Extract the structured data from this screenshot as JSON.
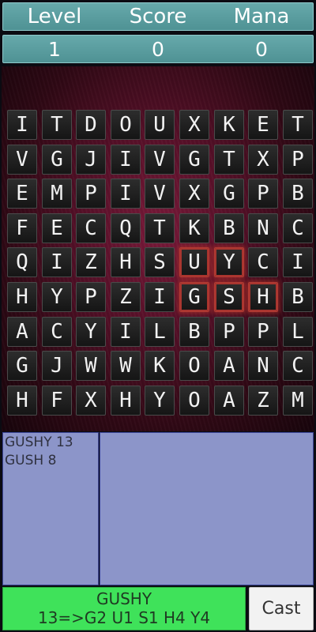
{
  "hud": {
    "labels": [
      "Level",
      "Score",
      "Mana"
    ],
    "values": [
      "1",
      "0",
      "0"
    ]
  },
  "board": {
    "rows": [
      [
        "I",
        "T",
        "D",
        "O",
        "U",
        "X",
        "K",
        "E",
        "T"
      ],
      [
        "V",
        "G",
        "J",
        "I",
        "V",
        "G",
        "T",
        "X",
        "P"
      ],
      [
        "E",
        "M",
        "P",
        "I",
        "V",
        "X",
        "G",
        "P",
        "B"
      ],
      [
        "F",
        "E",
        "C",
        "Q",
        "T",
        "K",
        "B",
        "N",
        "C"
      ],
      [
        "Q",
        "I",
        "Z",
        "H",
        "S",
        "U",
        "Y",
        "C",
        "I"
      ],
      [
        "H",
        "Y",
        "P",
        "Z",
        "I",
        "G",
        "S",
        "H",
        "B"
      ],
      [
        "A",
        "C",
        "Y",
        "I",
        "L",
        "B",
        "P",
        "P",
        "L"
      ],
      [
        "G",
        "J",
        "W",
        "W",
        "K",
        "O",
        "A",
        "N",
        "C"
      ],
      [
        "H",
        "F",
        "X",
        "H",
        "Y",
        "O",
        "A",
        "Z",
        "M"
      ]
    ],
    "selected": [
      [
        4,
        5
      ],
      [
        4,
        6
      ],
      [
        5,
        5
      ],
      [
        5,
        6
      ],
      [
        5,
        7
      ]
    ]
  },
  "found_words": [
    "GUSHY 13",
    "GUSH 8"
  ],
  "current": {
    "word": "GUSHY",
    "score_line": "13=>G2 U1 S1 H4 Y4"
  },
  "cast_label": "Cast",
  "colors": {
    "hud": "#5a9d9f",
    "panel": "#8c95c9",
    "current_word_bg": "#3fe25a",
    "selection": "#a8352f"
  }
}
